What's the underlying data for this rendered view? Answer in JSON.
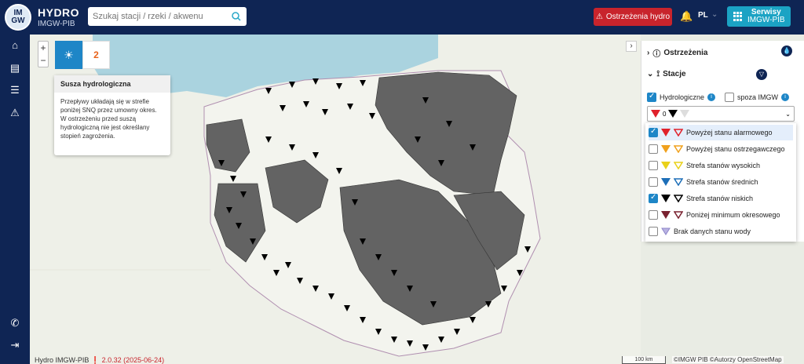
{
  "header": {
    "logo_text": "IM GW",
    "brand_title": "HYDRO",
    "brand_subtitle": "IMGW-PIB",
    "search_placeholder": "Szukaj stacji / rzeki / akwenu",
    "search_icon": "search-icon",
    "warnings_button": "Ostrzeżenia hydro",
    "language": "PL",
    "services_title": "Serwisy",
    "services_subtitle": "IMGW-PIB",
    "colors": {
      "bg": "#0f2554",
      "warn": "#c8242c",
      "services": "#1ba3c4"
    }
  },
  "sidebar": {
    "icons": [
      "home-icon",
      "map-icon",
      "list-icon",
      "warning-icon",
      "phone-icon",
      "logout-icon"
    ]
  },
  "map": {
    "tile_number": "2",
    "popup": {
      "title": "Susza hydrologiczna",
      "body": "Przepływy układają się w strefie poniżej SNQ przez umowny okres. W ostrzeżeniu przed suszą hydrologiczną nie jest określany stopień zagrożenia."
    },
    "zoom_in": "+",
    "zoom_out": "−",
    "footer_app": "Hydro IMGW-PIB",
    "footer_version": "2.0.32 (2025-06-24)",
    "scale": "100 km",
    "attribution": "©IMGW PIB ©Autorzy OpenStreetMap",
    "colors": {
      "drought_region": "#636363",
      "land": "#eef0e8",
      "sea": "#aad3df"
    }
  },
  "panel": {
    "warnings_label": "Ostrzeżenia",
    "stations_label": "Stacje",
    "hydro_label": "Hydrologiczne",
    "outside_label": "spoza IMGW",
    "select_value": "0",
    "options": [
      {
        "label": "Powyżej stanu alarmowego",
        "checked": true,
        "color": "#e0212b"
      },
      {
        "label": "Powyżej stanu ostrzegawczego",
        "checked": false,
        "color": "#f0a11d"
      },
      {
        "label": "Strefa stanów wysokich",
        "checked": false,
        "color": "#e9d11a"
      },
      {
        "label": "Strefa stanów średnich",
        "checked": false,
        "color": "#1e6fb8"
      },
      {
        "label": "Strefa stanów niskich",
        "checked": true,
        "color": "#000000"
      },
      {
        "label": "Poniżej minimum okresowego",
        "checked": false,
        "color": "#7a2230"
      },
      {
        "label": "Brak danych stanu wody",
        "checked": false,
        "color": "#b9b3e2"
      }
    ]
  }
}
